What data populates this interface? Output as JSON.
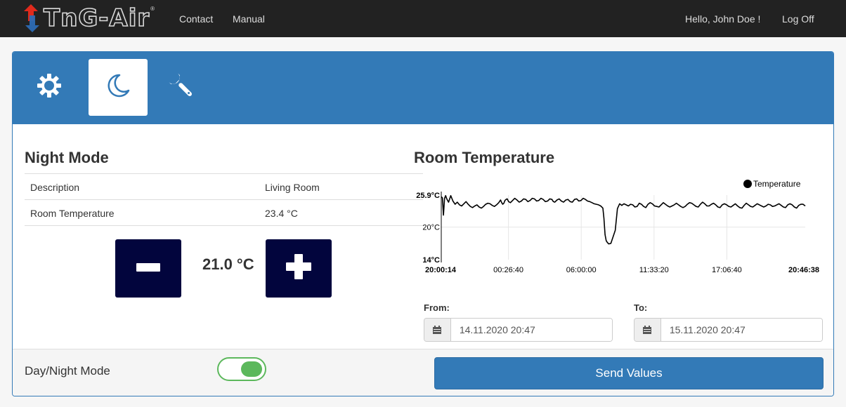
{
  "navbar": {
    "brand": "TnG-Air",
    "brand_mark": "®",
    "links": {
      "contact": "Contact",
      "manual": "Manual"
    },
    "greeting": "Hello, John Doe !",
    "logoff": "Log Off"
  },
  "mode_tabs": [
    {
      "icon": "sun-icon",
      "active": false
    },
    {
      "icon": "moon-icon",
      "active": true
    },
    {
      "icon": "wrench-icon",
      "active": false
    }
  ],
  "night_mode": {
    "title": "Night Mode",
    "rows": [
      {
        "label": "Description",
        "value": "Living Room"
      },
      {
        "label": "Room Temperature",
        "value": "23.4 °C"
      }
    ],
    "setpoint": "21.0 °C"
  },
  "room_temperature": {
    "title": "Room Temperature",
    "from_label": "From:",
    "to_label": "To:",
    "from_value": "14.11.2020 20:47",
    "to_value": "15.11.2020 20:47"
  },
  "chart_data": {
    "type": "line",
    "legend": [
      "Temperature"
    ],
    "legend_position": "top-right",
    "y_ticks": [
      "25.9°C",
      "20°C",
      "14°C"
    ],
    "ylim": [
      14,
      25.9
    ],
    "x_ticks": [
      "20:00:14",
      "00:26:40",
      "06:00:00",
      "11:33:20",
      "17:06:40",
      "20:46:38"
    ],
    "grid": true,
    "series": [
      {
        "name": "Temperature",
        "color": "#000000",
        "x": [
          0,
          0.3,
          0.6,
          0.9,
          1.2,
          1.5,
          2,
          2.6,
          3.2,
          3.8,
          4.4,
          5,
          5.6,
          6.2,
          6.8,
          7.4,
          8,
          8.6,
          9.2,
          9.8,
          10.4,
          11,
          11.6,
          12.2,
          12.8,
          13.4,
          14,
          14.6,
          15.2,
          15.8,
          16.3,
          16.6,
          16.9,
          17.2,
          17.5,
          17.8,
          18.1,
          18.5,
          19,
          19.6,
          20.2,
          20.8,
          21.4,
          22,
          22.6,
          23.2,
          23.8,
          24.4,
          25,
          25.6,
          26.2,
          26.8,
          27.4,
          28,
          28.6,
          29.2,
          29.8,
          30.4,
          30.8,
          31.2,
          31.8,
          32.4,
          33,
          33.6,
          34.2,
          34.8,
          35.4,
          36,
          36.6,
          37.2,
          37.8,
          38.4,
          39,
          39.6,
          40.2,
          40.8,
          41.4,
          42,
          42.6,
          43.2,
          43.8,
          44.4,
          44.7,
          45,
          45.3,
          45.6,
          46,
          46.6,
          47.2,
          47.8,
          48.4,
          49,
          49.6,
          50.2,
          50.8,
          51.4,
          52,
          52.6,
          53.2,
          53.8,
          54.4,
          55,
          55.6,
          56.2,
          56.8,
          57.4,
          58,
          58.6,
          59.2,
          59.8,
          60.4,
          61,
          61.6,
          62.2,
          62.8,
          63.4,
          64,
          64.6,
          65.2,
          65.8,
          66.4,
          67,
          67.6,
          68.2,
          68.8,
          69.4,
          70,
          70.6,
          71.2,
          71.8,
          72.4,
          73,
          73.6,
          74.2,
          74.8,
          75.4,
          76,
          76.6,
          77.2,
          77.8,
          78.4,
          79,
          79.6,
          80.2,
          80.8,
          81.4,
          82,
          82.6,
          83.2,
          83.8,
          84.4,
          85,
          85.6,
          86.2,
          86.8,
          87.4,
          88,
          88.6,
          89.2,
          89.8,
          90.4,
          91,
          91.6,
          92.2,
          92.8,
          93.4,
          94,
          94.6,
          95.2,
          95.8,
          96.4,
          97,
          97.6,
          98.2,
          98.8,
          99.4,
          100
        ],
        "y": [
          25.6,
          25.4,
          22.2,
          25.3,
          25.8,
          25.2,
          24.6,
          25.8,
          24.8,
          24.2,
          24.6,
          24.1,
          23.9,
          24.3,
          24.7,
          24.2,
          23.8,
          23.6,
          23.9,
          24.1,
          23.7,
          23.5,
          23.8,
          24.2,
          24.4,
          24.3,
          24,
          23.8,
          24.1,
          24.5,
          25.0,
          24.5,
          24.2,
          24.4,
          24.9,
          25.1,
          25.2,
          24.7,
          24.5,
          24.9,
          25.3,
          25.0,
          24.6,
          24.8,
          25.2,
          25.1,
          24.7,
          24.9,
          25.3,
          25.2,
          24.8,
          24.9,
          25.3,
          25.1,
          24.7,
          24.8,
          25.2,
          25.1,
          24.7,
          24.6,
          25.0,
          25.2,
          24.8,
          24.6,
          25.0,
          25.1,
          24.7,
          24.6,
          25.1,
          25.2,
          24.8,
          24.9,
          25.3,
          25.1,
          24.8,
          24.7,
          24.5,
          24.3,
          24.2,
          24.1,
          23.9,
          23.5,
          21.6,
          18.6,
          17.5,
          17.2,
          16.9,
          17.0,
          18.2,
          19.4,
          23.4,
          24.3,
          24.0,
          24.3,
          24.1,
          23.9,
          24.2,
          24.1,
          23.7,
          23.8,
          24.4,
          24.2,
          23.8,
          23.6,
          24.2,
          24.5,
          24.3,
          23.9,
          23.8,
          23.7,
          24.1,
          24.5,
          24.2,
          23.9,
          23.7,
          23.9,
          24.1,
          24.4,
          24.1,
          23.8,
          23.6,
          23.8,
          24.2,
          24.5,
          24.4,
          24.1,
          23.8,
          23.7,
          24.2,
          24.6,
          24.3,
          23.9,
          23.9,
          24.2,
          24.4,
          24.1,
          23.7,
          23.6,
          24.1,
          24.3,
          24.1,
          23.8,
          23.7,
          24.0,
          24.3,
          23.9,
          23.6,
          23.5,
          24.0,
          24.4,
          24.1,
          23.8,
          23.7,
          24.0,
          24.3,
          24.1,
          23.9,
          23.7,
          23.9,
          24.2,
          24.1,
          23.8,
          23.9,
          24.1,
          24.3,
          24.0,
          23.7,
          23.6,
          24.1,
          24.3,
          24.1,
          23.7,
          23.5,
          24.0,
          24.2,
          24.2,
          23.9
        ]
      }
    ]
  },
  "footer": {
    "mode_label": "Day/Night Mode",
    "toggle_on": true,
    "send_label": "Send Values"
  }
}
